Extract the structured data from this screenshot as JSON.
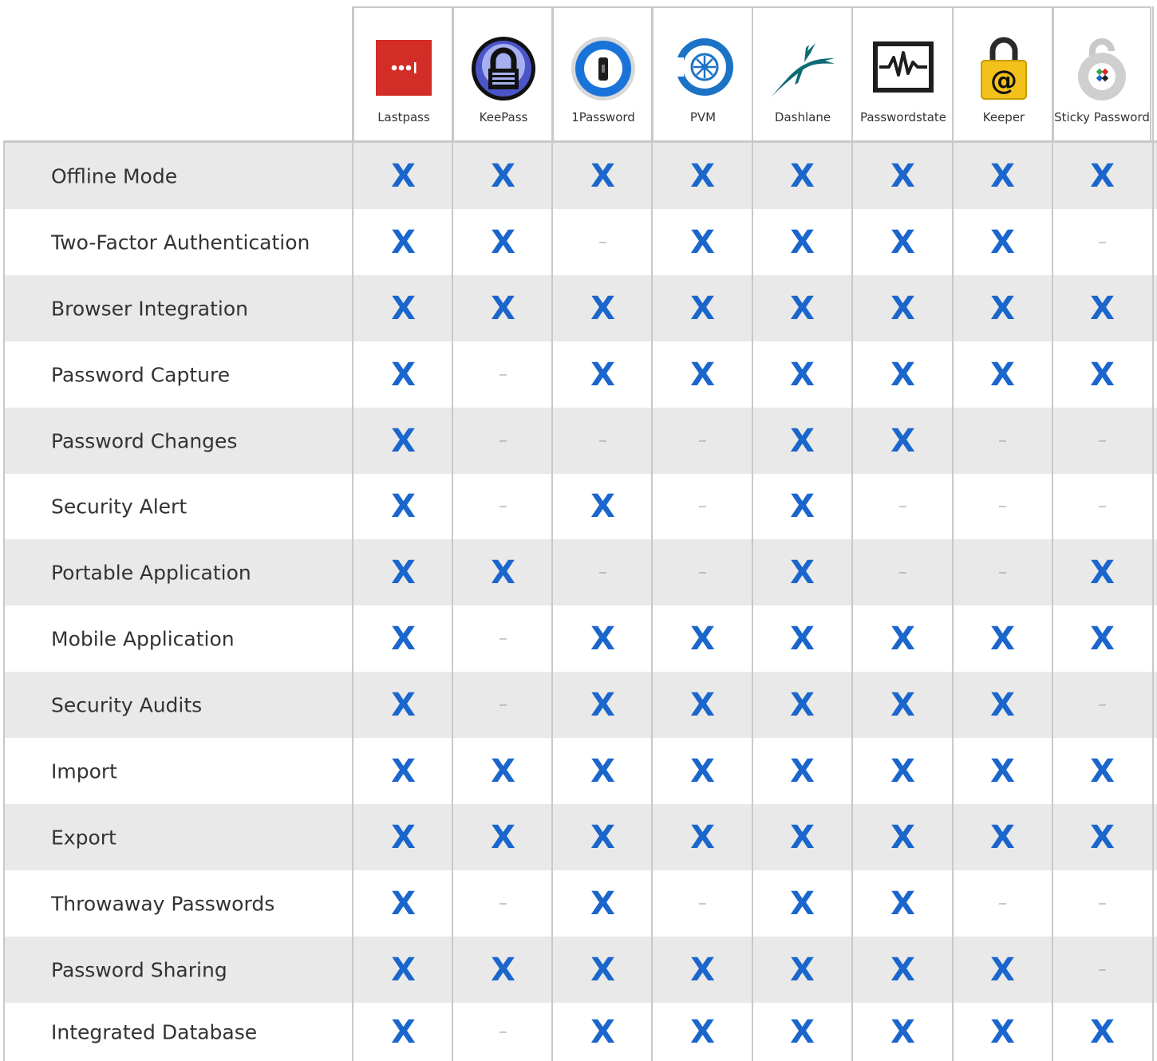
{
  "products": [
    {
      "name": "Lastpass",
      "icon": "lastpass-logo-icon"
    },
    {
      "name": "KeePass",
      "icon": "keepass-padlock-logo-icon"
    },
    {
      "name": "1Password",
      "icon": "onepassword-keyhole-logo-icon"
    },
    {
      "name": "PVM",
      "icon": "pvm-wheel-logo-icon"
    },
    {
      "name": "Dashlane",
      "icon": "dashlane-gazelle-logo-icon"
    },
    {
      "name": "Passwordstate",
      "icon": "passwordstate-monitor-logo-icon"
    },
    {
      "name": "Keeper",
      "icon": "keeper-padlock-at-logo-icon"
    },
    {
      "name": "Sticky Password",
      "icon": "sticky-password-lock-logo-icon"
    }
  ],
  "mark_symbol": "X",
  "absent_symbol": "–",
  "colors": {
    "mark": "#1a66cc",
    "shade": "#e9e9e9",
    "border": "#c9c9c9",
    "absent": "#9a9a9a"
  },
  "rows": [
    {
      "feature": "Offline Mode",
      "support": [
        1,
        1,
        1,
        1,
        1,
        1,
        1,
        1
      ]
    },
    {
      "feature": "Two-Factor Authentication",
      "support": [
        1,
        1,
        0,
        1,
        1,
        1,
        1,
        0
      ]
    },
    {
      "feature": "Browser Integration",
      "support": [
        1,
        1,
        1,
        1,
        1,
        1,
        1,
        1
      ]
    },
    {
      "feature": "Password Capture",
      "support": [
        1,
        0,
        1,
        1,
        1,
        1,
        1,
        1
      ]
    },
    {
      "feature": "Password Changes",
      "support": [
        1,
        0,
        0,
        0,
        1,
        1,
        0,
        0
      ]
    },
    {
      "feature": "Security Alert",
      "support": [
        1,
        0,
        1,
        0,
        1,
        0,
        0,
        0
      ]
    },
    {
      "feature": "Portable Application",
      "support": [
        1,
        1,
        0,
        0,
        1,
        0,
        0,
        1
      ]
    },
    {
      "feature": "Mobile Application",
      "support": [
        1,
        0,
        1,
        1,
        1,
        1,
        1,
        1
      ]
    },
    {
      "feature": "Security Audits",
      "support": [
        1,
        0,
        1,
        1,
        1,
        1,
        1,
        0
      ]
    },
    {
      "feature": "Import",
      "support": [
        1,
        1,
        1,
        1,
        1,
        1,
        1,
        1
      ]
    },
    {
      "feature": "Export",
      "support": [
        1,
        1,
        1,
        1,
        1,
        1,
        1,
        1
      ]
    },
    {
      "feature": "Throwaway Passwords",
      "support": [
        1,
        0,
        1,
        0,
        1,
        1,
        0,
        0
      ]
    },
    {
      "feature": "Password Sharing",
      "support": [
        1,
        1,
        1,
        1,
        1,
        1,
        1,
        0
      ]
    },
    {
      "feature": "Integrated Database",
      "support": [
        1,
        0,
        1,
        1,
        1,
        1,
        1,
        1
      ]
    }
  ]
}
